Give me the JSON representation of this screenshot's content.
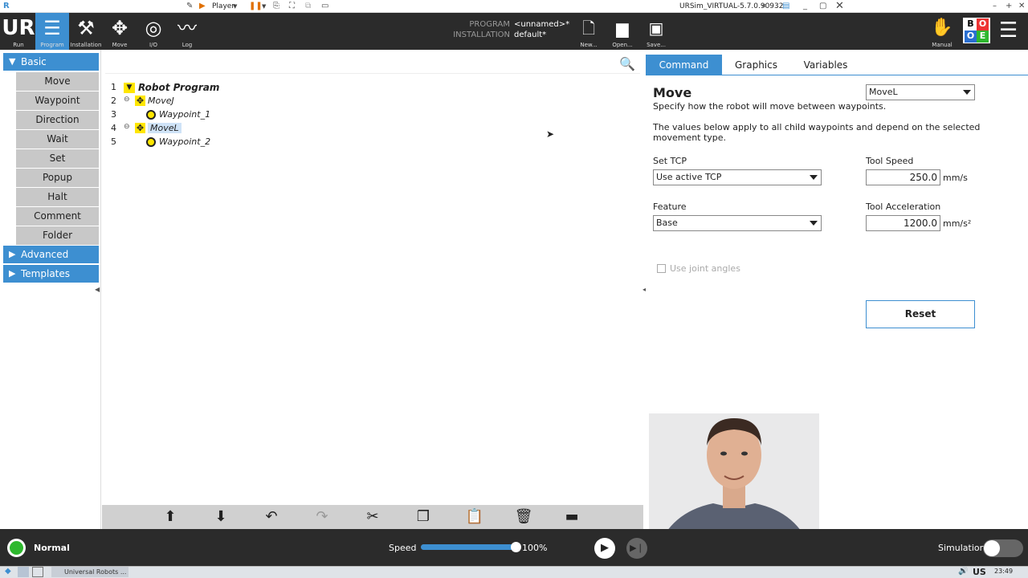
{
  "titlebar": {
    "player_label": "Player",
    "window_title": "URSim_VIRTUAL-5.7.0.90932"
  },
  "header": {
    "nav": [
      {
        "label": "Run"
      },
      {
        "label": "Program"
      },
      {
        "label": "Installation"
      },
      {
        "label": "Move"
      },
      {
        "label": "I/O"
      },
      {
        "label": "Log"
      }
    ],
    "program_key": "PROGRAM",
    "program_value": "<unnamed>*",
    "installation_key": "INSTALLATION",
    "installation_value": "default*",
    "file_actions": [
      {
        "label": "New..."
      },
      {
        "label": "Open..."
      },
      {
        "label": "Save..."
      }
    ],
    "manual_label": "Manual",
    "boe": [
      "B",
      "O",
      "O",
      "E"
    ]
  },
  "sidebar": {
    "basic_label": "Basic",
    "basic_items": [
      "Move",
      "Waypoint",
      "Direction",
      "Wait",
      "Set",
      "Popup",
      "Halt",
      "Comment",
      "Folder"
    ],
    "advanced_label": "Advanced",
    "templates_label": "Templates"
  },
  "tree": {
    "lines": [
      {
        "num": "1",
        "label": "Robot Program"
      },
      {
        "num": "2",
        "label": "MoveJ"
      },
      {
        "num": "3",
        "label": "Waypoint_1"
      },
      {
        "num": "4",
        "label": "MoveL"
      },
      {
        "num": "5",
        "label": "Waypoint_2"
      }
    ]
  },
  "panel": {
    "tabs": [
      "Command",
      "Graphics",
      "Variables"
    ],
    "title": "Move",
    "move_type": "MoveL",
    "desc1": "Specify how the robot will move between waypoints.",
    "desc2": "The values below apply to all child waypoints and depend on the selected movement type.",
    "set_tcp_label": "Set TCP",
    "set_tcp_value": "Use active TCP",
    "feature_label": "Feature",
    "feature_value": "Base",
    "tool_speed_label": "Tool Speed",
    "tool_speed_value": "250.0",
    "tool_speed_unit": "mm/s",
    "tool_accel_label": "Tool Acceleration",
    "tool_accel_value": "1200.0",
    "tool_accel_unit": "mm/s²",
    "joint_angles_label": "Use joint angles",
    "reset_label": "Reset"
  },
  "status": {
    "mode": "Normal",
    "speed_label": "Speed",
    "speed_value": "100%",
    "speed_fraction": 1.0,
    "simulation_label": "Simulation"
  },
  "taskbar": {
    "app_label": "Universal Robots ...",
    "locale": "US",
    "time": "23:49"
  },
  "colors": {
    "accent": "#3d8fd1",
    "header_bg": "#2b2b2b",
    "status_green": "#2eb82e"
  }
}
